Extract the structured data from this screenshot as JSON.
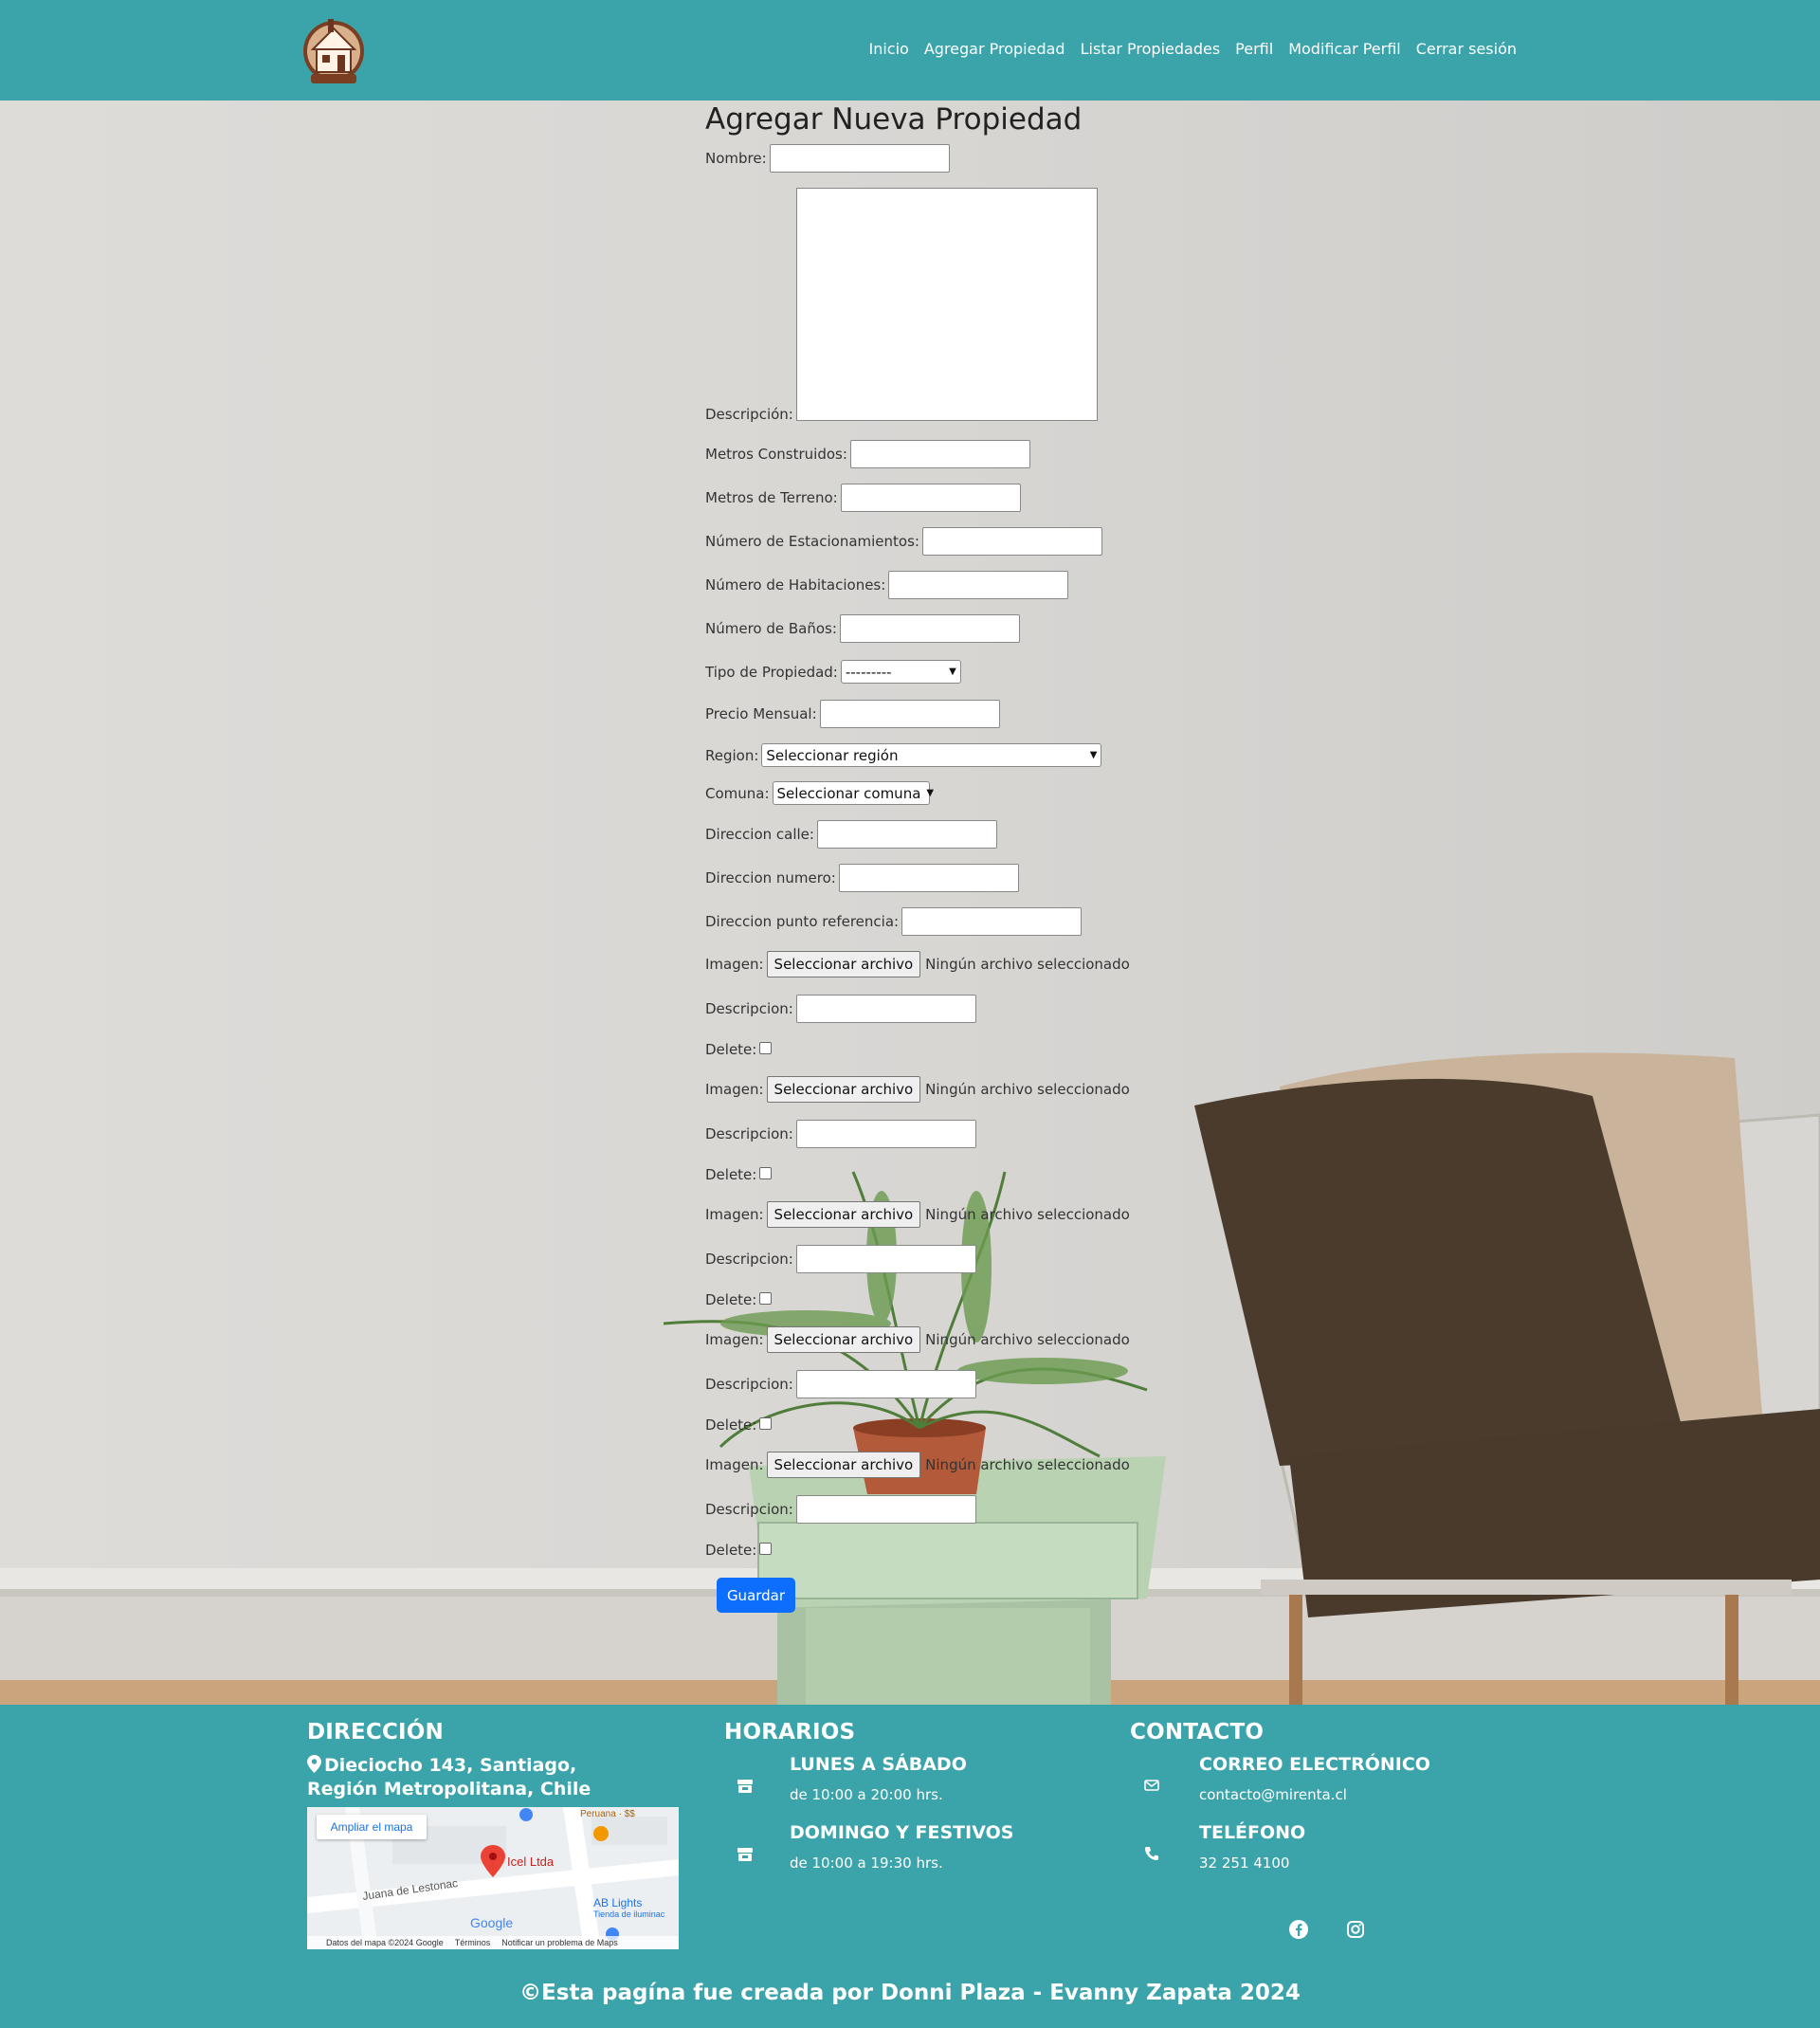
{
  "nav": {
    "items": [
      "Inicio",
      "Agregar Propiedad",
      "Listar Propiedades",
      "Perfil",
      "Modificar Perfil",
      "Cerrar sesión"
    ]
  },
  "form": {
    "title": "Agregar Nueva Propiedad",
    "nombre_label": "Nombre:",
    "descripcion_label": "Descripción:",
    "metros_construidos_label": "Metros Construidos:",
    "metros_terreno_label": "Metros de Terreno:",
    "estacionamientos_label": "Número de Estacionamientos:",
    "habitaciones_label": "Número de Habitaciones:",
    "banos_label": "Número de Baños:",
    "tipo_label": "Tipo de Propiedad:",
    "tipo_value": "---------",
    "precio_label": "Precio Mensual:",
    "region_label": "Region:",
    "region_value": "Seleccionar región",
    "comuna_label": "Comuna:",
    "comuna_value": "Seleccionar comuna",
    "calle_label": "Direccion calle:",
    "numero_label": "Direccion numero:",
    "referencia_label": "Direccion punto referencia:",
    "images": [
      {
        "imagen_label": "Imagen:",
        "button": "Seleccionar archivo",
        "status": "Ningún archivo seleccionado",
        "desc_label": "Descripcion:",
        "delete_label": "Delete:"
      },
      {
        "imagen_label": "Imagen:",
        "button": "Seleccionar archivo",
        "status": "Ningún archivo seleccionado",
        "desc_label": "Descripcion:",
        "delete_label": "Delete:"
      },
      {
        "imagen_label": "Imagen:",
        "button": "Seleccionar archivo",
        "status": "Ningún archivo seleccionado",
        "desc_label": "Descripcion:",
        "delete_label": "Delete:"
      },
      {
        "imagen_label": "Imagen:",
        "button": "Seleccionar archivo",
        "status": "Ningún archivo seleccionado",
        "desc_label": "Descripcion:",
        "delete_label": "Delete:"
      },
      {
        "imagen_label": "Imagen:",
        "button": "Seleccionar archivo",
        "status": "Ningún archivo seleccionado",
        "desc_label": "Descripcion:",
        "delete_label": "Delete:"
      }
    ],
    "save_button": "Guardar"
  },
  "footer": {
    "direccion_title": "DIRECCIÓN",
    "address": "Dieciocho 143, Santiago, Región Metropolitana, Chile",
    "map": {
      "enlarge": "Ampliar el mapa",
      "place": "Icel Ltda",
      "street": "Juana de Lestonac",
      "poi1": "Peruana · $$",
      "poi2": "AB Lights",
      "poi2_sub": "Tienda de iluminac",
      "brand": "Google",
      "attribution": "Datos del mapa ©2024 Google",
      "terms": "Términos",
      "report": "Notificar un problema de Maps"
    },
    "horarios_title": "HORARIOS",
    "weekday_title": "LUNES A SÁBADO",
    "weekday_hours": "de 10:00 a 20:00 hrs.",
    "weekend_title": "DOMINGO Y FESTIVOS",
    "weekend_hours": "de 10:00 a 19:30 hrs.",
    "contacto_title": "CONTACTO",
    "email_title": "CORREO ELECTRÓNICO",
    "email": "contacto@mirenta.cl",
    "phone_title": "TELÉFONO",
    "phone": "32 251 4100",
    "copyright": "©Esta pagína fue creada por Donni Plaza - Evanny Zapata 2024"
  },
  "colors": {
    "brand_teal": "#3ba3aa",
    "primary_button": "#0d6efd"
  },
  "icons": [
    "logo-house-icon",
    "map-marker-icon",
    "store-icon",
    "envelope-icon",
    "phone-icon",
    "facebook-icon",
    "instagram-icon"
  ]
}
